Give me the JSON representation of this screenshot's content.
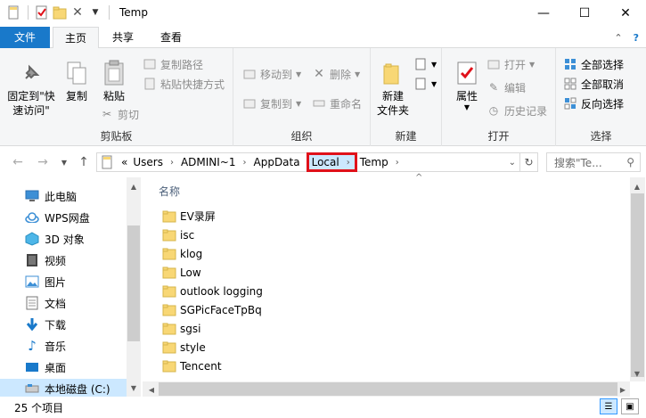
{
  "window": {
    "title": "Temp",
    "minimize": "—",
    "maximize": "☐",
    "close": "✕"
  },
  "ribbon_tabs": {
    "file": "文件",
    "home": "主页",
    "share": "共享",
    "view": "查看"
  },
  "ribbon": {
    "clipboard": {
      "label": "剪贴板",
      "pin": "固定到\"快速访问\"",
      "copy": "复制",
      "paste": "粘贴",
      "copy_path": "复制路径",
      "paste_shortcut": "粘贴快捷方式",
      "cut": "剪切"
    },
    "organize": {
      "label": "组织",
      "move_to": "移动到",
      "copy_to": "复制到",
      "delete": "删除",
      "rename": "重命名"
    },
    "new": {
      "label": "新建",
      "new_folder": "新建\n文件夹"
    },
    "open": {
      "label": "打开",
      "properties": "属性",
      "open": "打开",
      "edit": "编辑",
      "history": "历史记录"
    },
    "select": {
      "label": "选择",
      "select_all": "全部选择",
      "select_none": "全部取消",
      "invert": "反向选择"
    }
  },
  "address": {
    "overflow": "«",
    "crumbs": [
      "Users",
      "ADMINI~1",
      "AppData",
      "Local",
      "Temp"
    ],
    "search_placeholder": "搜索\"Te..."
  },
  "nav_pane": {
    "items": [
      {
        "label": "此电脑",
        "icon": "computer-icon"
      },
      {
        "label": "WPS网盘",
        "icon": "cloud-icon"
      },
      {
        "label": "3D 对象",
        "icon": "cube-icon"
      },
      {
        "label": "视频",
        "icon": "video-icon"
      },
      {
        "label": "图片",
        "icon": "picture-icon"
      },
      {
        "label": "文档",
        "icon": "document-icon"
      },
      {
        "label": "下载",
        "icon": "download-icon"
      },
      {
        "label": "音乐",
        "icon": "music-icon"
      },
      {
        "label": "桌面",
        "icon": "desktop-icon"
      },
      {
        "label": "本地磁盘 (C:)",
        "icon": "drive-icon"
      }
    ]
  },
  "file_list": {
    "column_name": "名称",
    "items": [
      "EV录屏",
      "isc",
      "klog",
      "Low",
      "outlook logging",
      "SGPicFaceTpBq",
      "sgsi",
      "style",
      "Tencent"
    ]
  },
  "status": {
    "count": "25 个项目"
  },
  "colors": {
    "accent": "#1979ca",
    "highlight": "#e0111a",
    "folder": "#f8d775",
    "selection": "#cce8ff"
  }
}
